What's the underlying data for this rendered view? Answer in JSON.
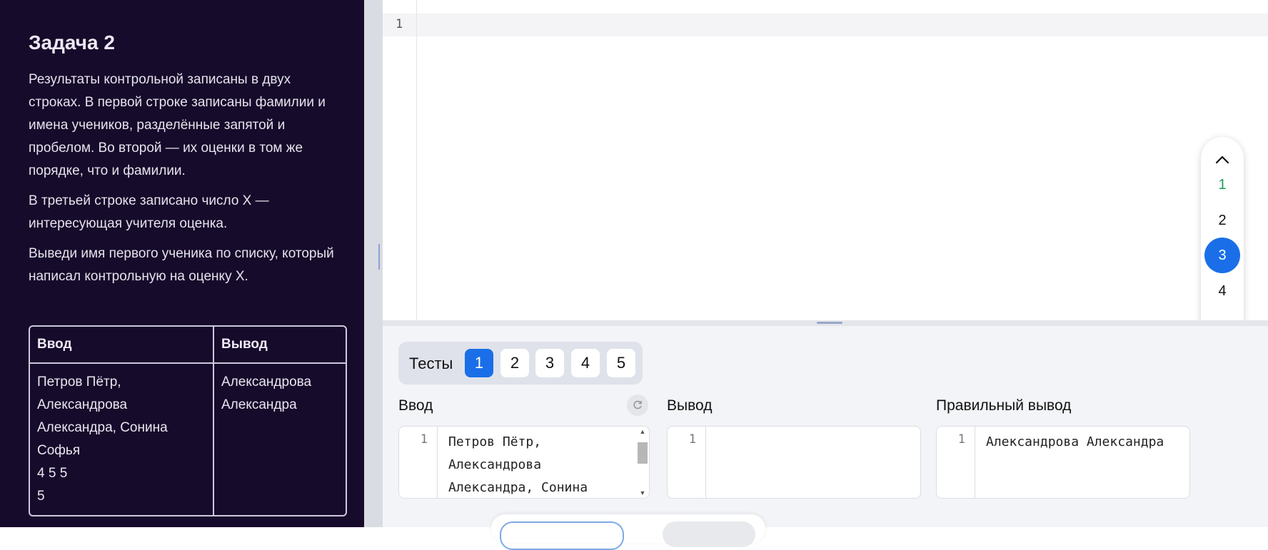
{
  "task": {
    "title": "Задача 2",
    "paragraphs": [
      "Результаты контрольной записаны в двух строках. В первой строке записаны фамилии и имена учеников, разделённые запятой и пробелом. Во второй — их оценки в том же порядке, что и фамилии.",
      "В третьей строке записано число X — интересующая учителя оценка.",
      "Выведи имя первого ученика по списку, который написал контрольную на оценку X."
    ],
    "example": {
      "input_header": "Ввод",
      "output_header": "Вывод",
      "input_text": "Петров Пётр,\nАлександрова\nАлександра, Сонина\nСофья\n4 5 5\n5",
      "output_text": "Александрова\nАлександра"
    }
  },
  "editor": {
    "line_number": "1"
  },
  "pager": {
    "up_icon": "chevron-up",
    "down_icon": "chevron-down",
    "items": [
      "1",
      "2",
      "3",
      "4"
    ],
    "active": "3",
    "completed": "1"
  },
  "tests": {
    "label": "Тесты",
    "buttons": [
      "1",
      "2",
      "3",
      "4",
      "5"
    ],
    "active": "1"
  },
  "panes": {
    "input": {
      "label": "Ввод",
      "line_number": "1",
      "text": "Петров Пётр,\nАлександрова\nАлександра, Сонина"
    },
    "output": {
      "label": "Вывод",
      "line_number": "1",
      "text": ""
    },
    "expected": {
      "label": "Правильный вывод",
      "line_number": "1",
      "text": "Александрова Александра"
    }
  },
  "colors": {
    "panel_bg": "#160b2a",
    "accent": "#1a6fe8",
    "completed": "#1a9e52"
  }
}
